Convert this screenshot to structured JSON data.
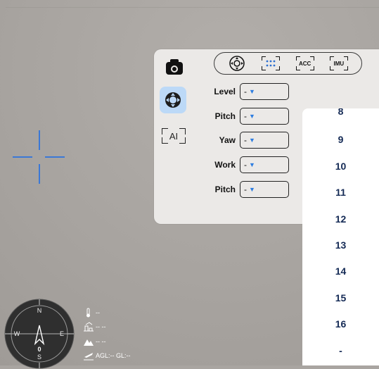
{
  "panel": {
    "side_ai_label": "AI",
    "segment_buttons": [
      {
        "icon": "gimbal-joystick-icon"
      },
      {
        "icon": "grid-dots-icon"
      },
      {
        "label": "ACC"
      },
      {
        "label": "IMU"
      }
    ],
    "rows": [
      {
        "label": "Level",
        "value": "-"
      },
      {
        "label": "Pitch",
        "value": "-"
      },
      {
        "label": "Yaw",
        "value": "-"
      },
      {
        "label": "Work",
        "value": "-"
      },
      {
        "label": "Pitch",
        "value": "-"
      }
    ]
  },
  "list": {
    "items": [
      "8",
      "9",
      "10",
      "11",
      "12",
      "13",
      "14",
      "15",
      "16",
      "-"
    ]
  },
  "compass": {
    "north": "N",
    "south": "S",
    "east": "E",
    "west": "W",
    "center_value": "0"
  },
  "telemetry": {
    "temperature": "--",
    "distance": "-- --",
    "altitude": "-- --",
    "agl_gl": "AGL:-- GL:--"
  },
  "colors": {
    "accent": "#3b78d6",
    "highlight": "#bcd9f7",
    "list_text": "#142a55"
  }
}
